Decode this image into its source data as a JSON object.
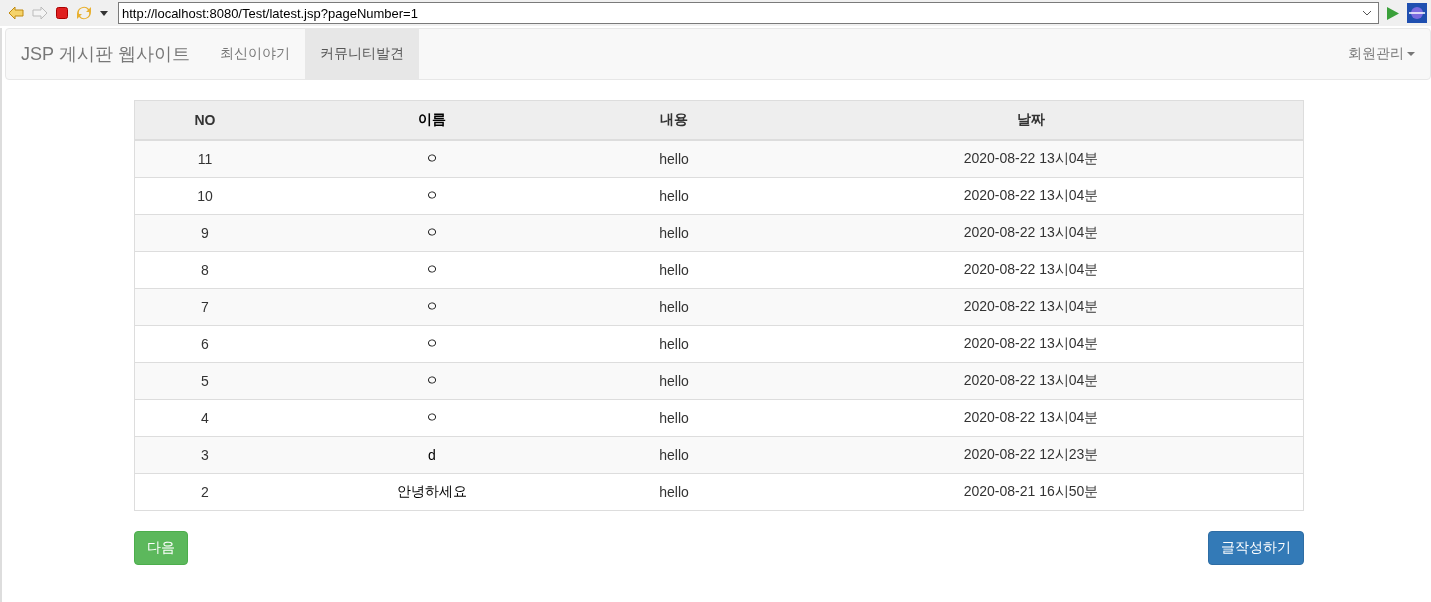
{
  "browser": {
    "url": "http://localhost:8080/Test/latest.jsp?pageNumber=1"
  },
  "navbar": {
    "brand": "JSP 게시판 웹사이트",
    "items": [
      {
        "label": "최신이야기",
        "selected": false
      },
      {
        "label": "커뮤니티발견",
        "selected": true
      }
    ],
    "menu": "회원관리"
  },
  "table": {
    "columns": [
      "NO",
      "이름",
      "내용",
      "날짜"
    ],
    "rows": [
      [
        "11",
        "ㅇ",
        "hello",
        "2020-08-22 13시04분"
      ],
      [
        "10",
        "ㅇ",
        "hello",
        "2020-08-22 13시04분"
      ],
      [
        "9",
        "ㅇ",
        "hello",
        "2020-08-22 13시04분"
      ],
      [
        "8",
        "ㅇ",
        "hello",
        "2020-08-22 13시04분"
      ],
      [
        "7",
        "ㅇ",
        "hello",
        "2020-08-22 13시04분"
      ],
      [
        "6",
        "ㅇ",
        "hello",
        "2020-08-22 13시04분"
      ],
      [
        "5",
        "ㅇ",
        "hello",
        "2020-08-22 13시04분"
      ],
      [
        "4",
        "ㅇ",
        "hello",
        "2020-08-22 13시04분"
      ],
      [
        "3",
        "d",
        "hello",
        "2020-08-22 12시23분"
      ],
      [
        "2",
        "안녕하세요",
        "hello",
        "2020-08-21 16시50분"
      ]
    ]
  },
  "buttons": [
    {
      "label": "다음",
      "kind": "success"
    },
    {
      "label": "글작성하기",
      "kind": "primary"
    }
  ]
}
